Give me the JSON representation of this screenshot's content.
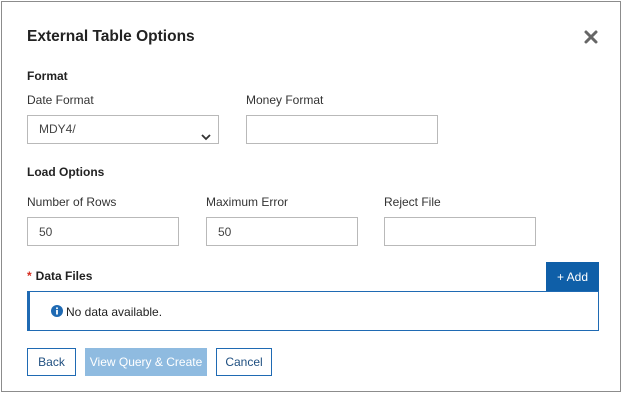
{
  "dialog": {
    "title": "External Table Options",
    "close_icon": "close-icon"
  },
  "format": {
    "section_label": "Format",
    "date_format": {
      "label": "Date Format",
      "value": "MDY4/",
      "icon": "chevron-down-icon"
    },
    "money_format": {
      "label": "Money Format",
      "value": ""
    }
  },
  "load_options": {
    "section_label": "Load Options",
    "number_of_rows": {
      "label": "Number of Rows",
      "value": "50"
    },
    "maximum_error": {
      "label": "Maximum Error",
      "value": "50"
    },
    "reject_file": {
      "label": "Reject File",
      "value": ""
    }
  },
  "data_files": {
    "required_marker": "*",
    "label": "Data Files",
    "add_label": "+ Add",
    "empty_text": "No data available.",
    "info_icon": "info-icon"
  },
  "footer": {
    "back_label": "Back",
    "view_query_label": "View Query & Create",
    "cancel_label": "Cancel"
  },
  "colors": {
    "primary": "#0f5fa8",
    "disabled": "#8fbbe0",
    "required": "#d62c1f"
  }
}
